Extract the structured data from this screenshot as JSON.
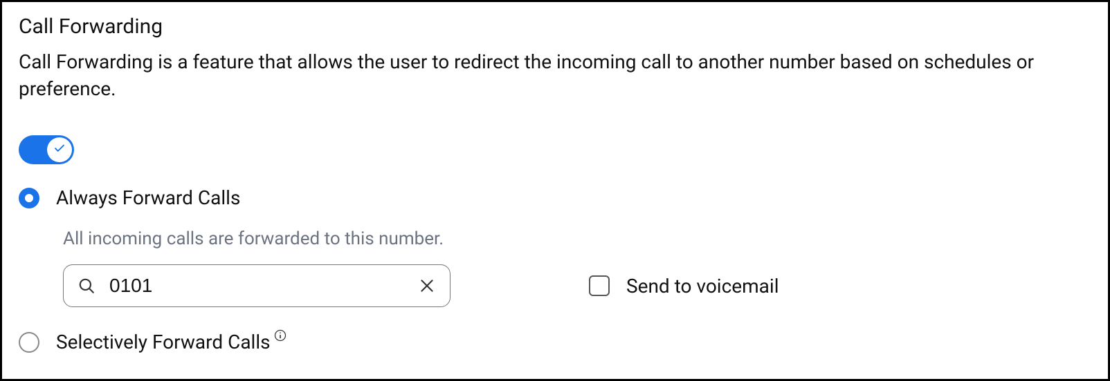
{
  "title": "Call Forwarding",
  "description": "Call Forwarding is a feature that allows the user to redirect the incoming call to another number based on schedules or preference.",
  "toggle": {
    "enabled": true
  },
  "options": {
    "always": {
      "label": "Always Forward Calls",
      "selected": true,
      "hint": "All incoming calls are forwarded to this number.",
      "number_value": "0101",
      "voicemail_label": "Send to voicemail",
      "voicemail_checked": false
    },
    "selective": {
      "label": "Selectively Forward Calls",
      "selected": false
    }
  }
}
